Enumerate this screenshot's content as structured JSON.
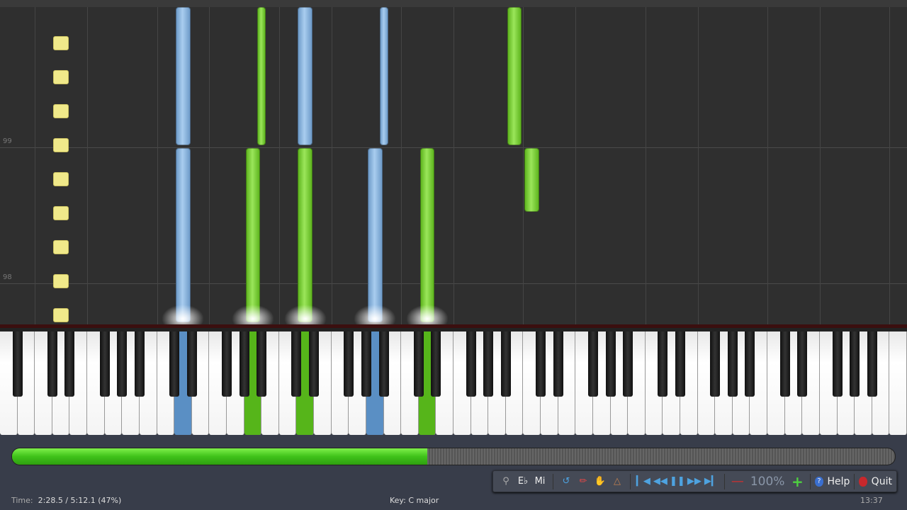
{
  "roll": {
    "measure_labels": [
      "99",
      "98"
    ],
    "marker_count": 9,
    "notes": [
      {
        "key": "w10",
        "hand": "left",
        "start": 0.0,
        "end": 1.28
      },
      {
        "key": "w10",
        "hand": "left",
        "start": 1.3,
        "end": 2.32
      },
      {
        "key": "w14",
        "hand": "right",
        "start": 0.0,
        "end": 1.28
      },
      {
        "key": "b14",
        "hand": "right",
        "start": 1.3,
        "end": 2.32
      },
      {
        "key": "w17",
        "hand": "right",
        "start": 0.0,
        "end": 1.28
      },
      {
        "key": "w17",
        "hand": "left",
        "start": 1.3,
        "end": 2.32
      },
      {
        "key": "w21",
        "hand": "left",
        "start": 0.0,
        "end": 1.28
      },
      {
        "key": "b21",
        "hand": "left",
        "start": 1.3,
        "end": 2.32
      },
      {
        "key": "w24",
        "hand": "right",
        "start": 0.0,
        "end": 1.28
      },
      {
        "key": "w29",
        "hand": "right",
        "start": 1.3,
        "end": 2.32
      },
      {
        "key": "w30",
        "hand": "right",
        "start": 0.81,
        "end": 1.28
      }
    ],
    "pressed": [
      {
        "key": "w10",
        "hand": "left"
      },
      {
        "key": "w14",
        "hand": "right"
      },
      {
        "key": "w17",
        "hand": "right"
      },
      {
        "key": "w21",
        "hand": "left"
      },
      {
        "key": "w24",
        "hand": "right"
      }
    ]
  },
  "progress": {
    "percent": 47
  },
  "toolbar": {
    "icons": [
      "magnifier-icon",
      "flat-label-icon",
      "mi-label-icon",
      "loop-icon",
      "pencil-icon",
      "hand-icon",
      "metronome-icon",
      "skip-start-icon",
      "rewind-icon",
      "pause-icon",
      "fast-forward-icon",
      "skip-end-icon"
    ],
    "eb_label": "E♭",
    "mi_label": "Mi",
    "zoom": "100%",
    "help_label": "Help",
    "quit_label": "Quit"
  },
  "status": {
    "time_label": "Time:",
    "time_value": "2:28.5 / 5:12.1 (47%)",
    "key": "Key: C major",
    "clock": "13:37"
  },
  "colors": {
    "left_hand": "#6e9bc9",
    "right_hand": "#7ad63a",
    "marker": "#f0e98a"
  }
}
